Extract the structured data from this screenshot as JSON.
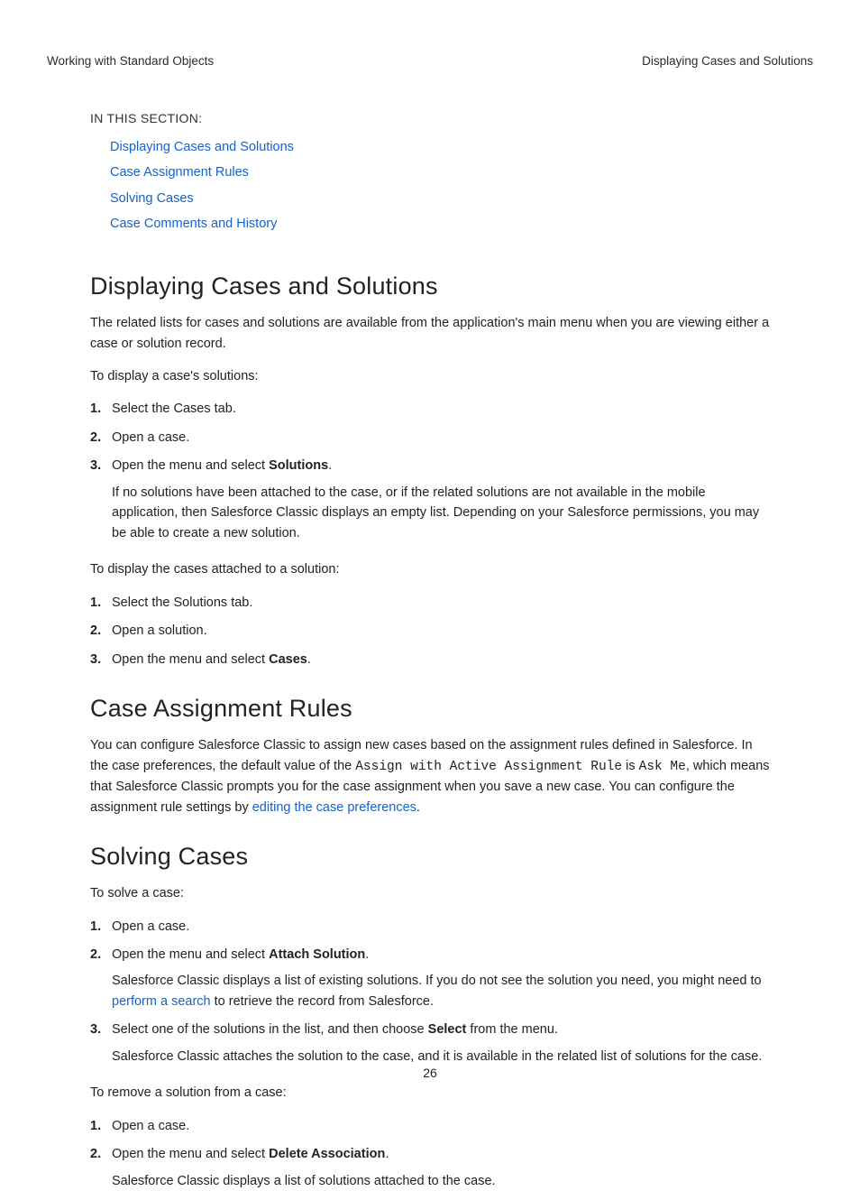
{
  "header": {
    "left": "Working with Standard Objects",
    "right": "Displaying Cases and Solutions"
  },
  "in_section": {
    "label": "IN THIS SECTION:",
    "links": [
      "Displaying Cases and Solutions",
      "Case Assignment Rules",
      "Solving Cases",
      "Case Comments and History"
    ]
  },
  "s1": {
    "title": "Displaying Cases and Solutions",
    "intro": "The related lists for cases and solutions are available from the application's main menu when you are viewing either a case or solution record.",
    "a_lead": "To display a case's solutions:",
    "a1": "Select the Cases tab.",
    "a2": "Open a case.",
    "a3_pre": "Open the menu and select ",
    "a3_bold": "Solutions",
    "a3_post": ".",
    "a3_sub": "If no solutions have been attached to the case, or if the related solutions are not available in the mobile application, then Salesforce Classic displays an empty list. Depending on your Salesforce permissions, you may be able to create a new solution.",
    "b_lead": "To display the cases attached to a solution:",
    "b1": "Select the Solutions tab.",
    "b2": "Open a solution.",
    "b3_pre": "Open the menu and select ",
    "b3_bold": "Cases",
    "b3_post": "."
  },
  "s2": {
    "title": "Case Assignment Rules",
    "p_pre": "You can configure Salesforce Classic to assign new cases based on the assignment rules defined in Salesforce. In the case preferences, the default value of the ",
    "code1": "Assign with Active Assignment Rule",
    "mid1": " is ",
    "code2": "Ask Me",
    "mid2": ", which means that Salesforce Classic prompts you for the case assignment when you save a new case. You can configure the assignment rule settings by ",
    "link": "editing the case preferences",
    "post": "."
  },
  "s3": {
    "title": "Solving Cases",
    "a_lead": "To solve a case:",
    "a1": "Open a case.",
    "a2_pre": "Open the menu and select ",
    "a2_bold": "Attach Solution",
    "a2_post": ".",
    "a2_sub_pre": "Salesforce Classic displays a list of existing solutions. If you do not see the solution you need, you might need to ",
    "a2_sub_link": "perform a search",
    "a2_sub_post": " to retrieve the record from Salesforce.",
    "a3_pre": "Select one of the solutions in the list, and then choose ",
    "a3_bold": "Select",
    "a3_post": " from the menu.",
    "a3_sub": "Salesforce Classic attaches the solution to the case, and it is available in the related list of solutions for the case.",
    "b_lead": "To remove a solution from a case:",
    "b1": "Open a case.",
    "b2_pre": "Open the menu and select ",
    "b2_bold": "Delete Association",
    "b2_post": ".",
    "b2_sub": "Salesforce Classic displays a list of solutions attached to the case."
  },
  "page_number": "26"
}
